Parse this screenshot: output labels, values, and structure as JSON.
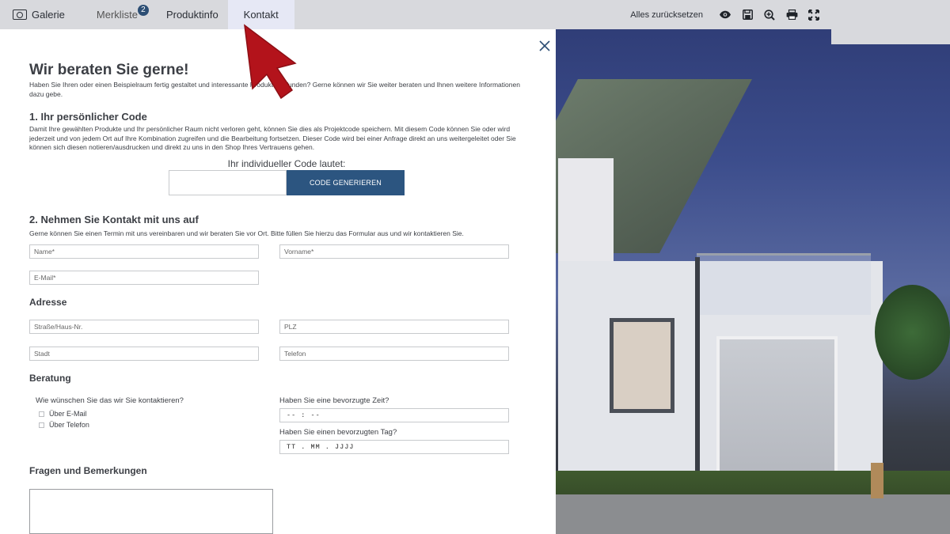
{
  "topbar": {
    "tabs": [
      {
        "label": "Galerie",
        "icon": "camera-icon"
      },
      {
        "label": "Merkliste",
        "badge": "2"
      },
      {
        "label": "Produktinfo"
      },
      {
        "label": "Kontakt",
        "active": true
      }
    ],
    "reset_label": "Alles zurücksetzen",
    "tools": [
      "eye-icon",
      "save-icon",
      "zoom-in-icon",
      "print-icon",
      "fullscreen-icon"
    ]
  },
  "modal": {
    "title": "Wir beraten Sie gerne!",
    "intro": "Haben Sie Ihren oder einen Beispielraum fertig gestaltet und interessante Produkte gefunden? Gerne können wir Sie weiter beraten und Ihnen weitere Informationen dazu gebe.",
    "section1": {
      "title": "1. Ihr persönlicher Code",
      "text": "Damit Ihre gewählten Produkte und Ihr persönlicher Raum nicht verloren geht, können Sie dies als Projektcode speichern. Mit diesem Code können Sie oder wird jederzeit und von jedem Ort auf Ihre Kombination zugreifen und die Bearbeitung fortsetzen. Dieser Code wird bei einer Anfrage direkt an uns weitergeleitet oder Sie können sich diesen notieren/ausdrucken und direkt zu uns in den Shop Ihres Vertrauens gehen.",
      "code_label": "Ihr individueller Code lautet:",
      "button_label": "CODE GENERIEREN"
    },
    "section2": {
      "title": "2. Nehmen Sie Kontakt mit uns auf",
      "text": "Gerne können Sie einen Termin mit uns vereinbaren und wir beraten Sie vor Ort. Bitte füllen Sie hierzu das Formular aus und wir kontaktieren Sie.",
      "name_placeholder": "Name*",
      "vorname_placeholder": "Vorname*",
      "email_placeholder": "E-Mail*"
    },
    "address": {
      "title": "Adresse",
      "street_placeholder": "Straße/Haus-Nr.",
      "plz_placeholder": "PLZ",
      "city_placeholder": "Stadt",
      "phone_placeholder": "Telefon"
    },
    "consultation": {
      "title": "Beratung",
      "contact_question": "Wie wünschen Sie das wir Sie kontaktieren?",
      "options": [
        "Über E-Mail",
        "Über Telefon"
      ],
      "time_question": "Haben Sie eine bevorzugte Zeit?",
      "time_value": "-- : --",
      "day_question": "Haben Sie einen bevorzugten Tag?",
      "day_value": "TT . MM . JJJJ"
    },
    "remarks": {
      "title": "Fragen und Bemerkungen"
    }
  },
  "colors": {
    "accent": "#2c5580",
    "pointer": "#b3131b"
  }
}
